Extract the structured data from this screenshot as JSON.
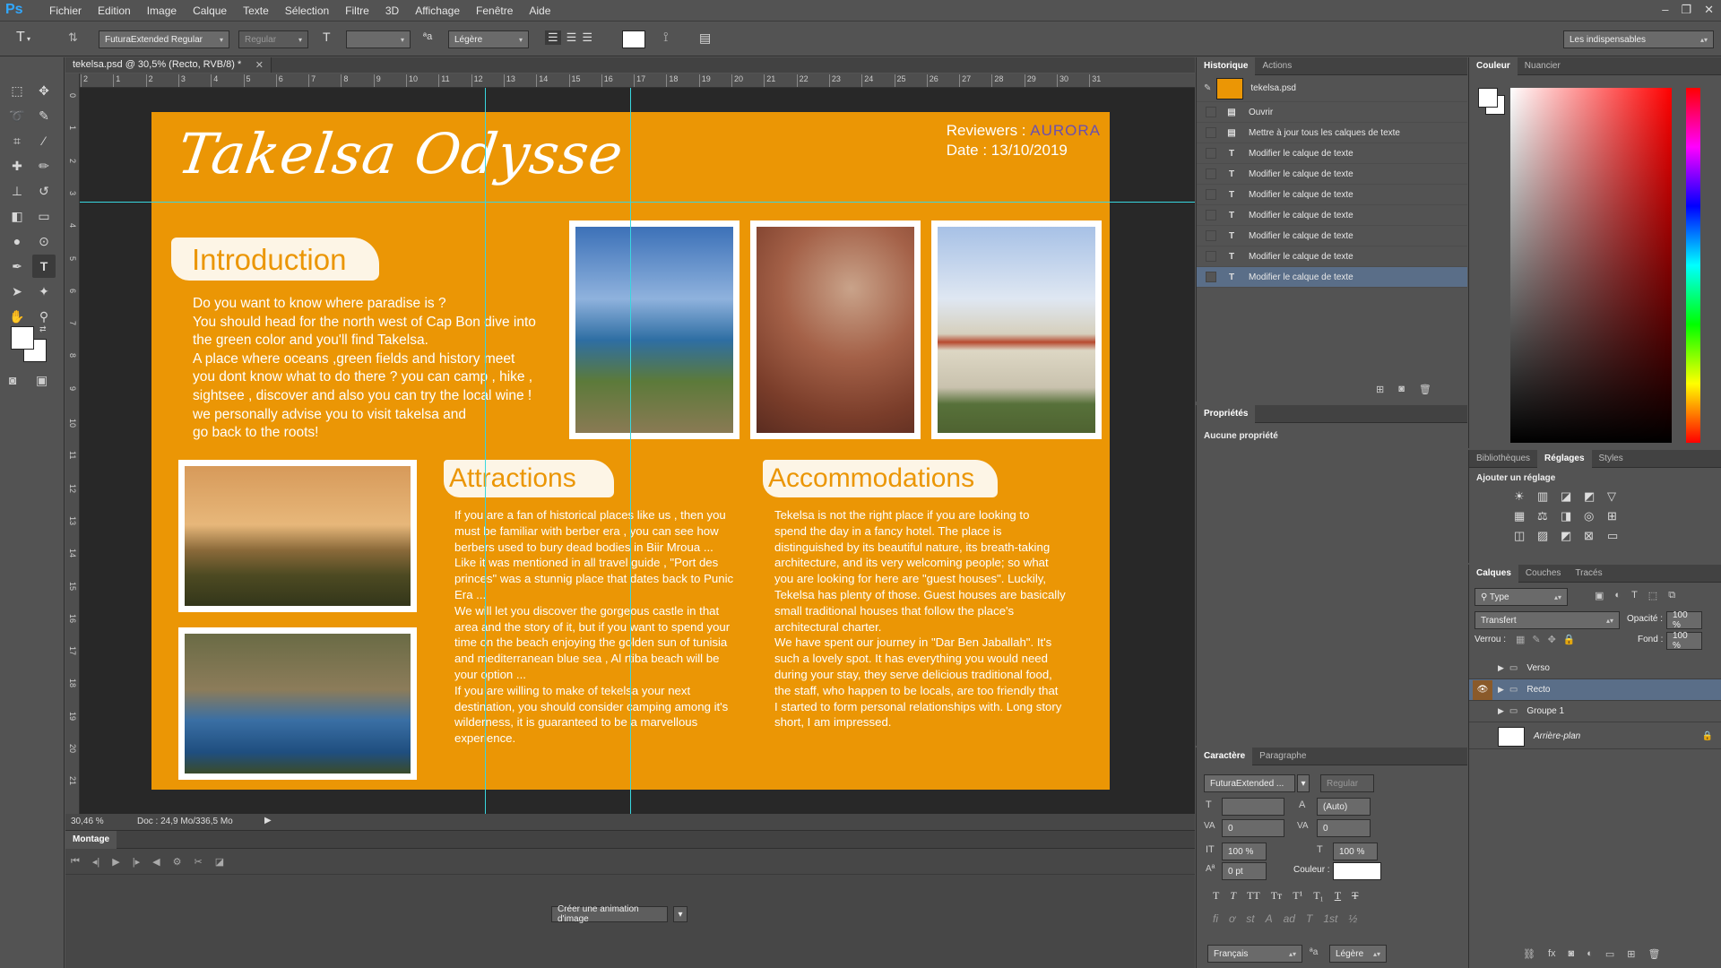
{
  "app": {
    "logo": "Ps"
  },
  "menu": [
    "Fichier",
    "Edition",
    "Image",
    "Calque",
    "Texte",
    "Sélection",
    "Filtre",
    "3D",
    "Affichage",
    "Fenêtre",
    "Aide"
  ],
  "options": {
    "font_family": "FuturaExtended Regular",
    "font_style": "Regular",
    "antialias": "Légère",
    "workspace": "Les indispensables"
  },
  "document": {
    "tab_title": "tekelsa.psd @ 30,5% (Recto, RVB/8) *",
    "zoom": "30,46 %",
    "doc_info": "Doc : 24,9 Mo/336,5 Mo",
    "ruler_h": [
      "2",
      "1",
      "2",
      "3",
      "4",
      "5",
      "6",
      "7",
      "8",
      "9",
      "10",
      "11",
      "12",
      "13",
      "14",
      "15",
      "16",
      "17",
      "18",
      "19",
      "20",
      "21",
      "22",
      "23",
      "24",
      "25",
      "26",
      "27",
      "28",
      "29",
      "30",
      "31"
    ],
    "ruler_v": [
      "0",
      "1",
      "2",
      "3",
      "4",
      "5",
      "6",
      "7",
      "8",
      "9",
      "10",
      "11",
      "12",
      "13",
      "14",
      "15",
      "16",
      "17",
      "18",
      "19",
      "20",
      "21"
    ]
  },
  "artwork": {
    "title": "Takelsa Odysse",
    "reviewers_label": "Reviewers :",
    "reviewers_brand": "AURORA",
    "date": "Date : 13/10/2019",
    "intro_heading": "Introduction",
    "intro_lines": [
      "Do you want to know where paradise is ?",
      "You should head for the north west of Cap Bon dive into",
      "the green color and you'll find Takelsa.",
      "A place where oceans ,green fields and history  meet",
      "you dont know what to do there ? you can camp , hike ,",
      "sightsee , discover and also you can try the local wine !",
      "we personally advise you to visit takelsa and",
      "go back to the roots!"
    ],
    "attractions_heading": "Attractions",
    "attractions_lines": [
      "If you are a fan of historical places like us , then you",
      "must be familiar with berber era , you can see how",
      "berbers used to bury dead bodies in Biir Mroua ...",
      "Like it was mentioned in all travel guide , \"Port des",
      "princes\"  was a stunnig place that dates back to Punic",
      "Era ...",
      "We will let you discover the gorgeous castle in that",
      "area and the story of it, but if you want to spend your",
      "time on the beach enjoying the golden sun of tunisia",
      "and mediterranean blue sea , Al rtiba beach will be",
      "your option ...",
      "If you are willing to make of tekelsa your next",
      "destination, you should consider camping among it's",
      "wilderness, it is guaranteed to be a marvellous",
      "experience."
    ],
    "accommodations_heading": "Accommodations",
    "accommodations_lines": [
      "Tekelsa is not the right place if you are looking to",
      "spend the day in a fancy hotel. The place is",
      "distinguished by its beautiful nature, its breath-taking",
      "architecture, and its very welcoming people; so what",
      "you are looking for here are \"guest houses\". Luckily,",
      "Tekelsa has plenty of those. Guest houses are basically",
      "small traditional houses that follow the place's",
      "architectural charter.",
      "We have spent our journey in \"Dar Ben Jaballah\". It's",
      "such a lovely spot. It has everything you would need",
      "during your stay, they serve delicious traditional food,",
      "the staff, who happen to be locals, are too friendly that",
      "I started to form personal relationships with. Long story",
      "short, I am impressed."
    ]
  },
  "timeline": {
    "title": "Montage",
    "create_button": "Créer une animation d'image"
  },
  "history": {
    "tabs": [
      "Historique",
      "Actions"
    ],
    "snapshot": "tekelsa.psd",
    "items": [
      {
        "label": "Ouvrir",
        "icon": "doc"
      },
      {
        "label": "Mettre à jour tous les calques de texte",
        "icon": "doc"
      },
      {
        "label": "Modifier le calque de texte",
        "icon": "T"
      },
      {
        "label": "Modifier le calque de texte",
        "icon": "T"
      },
      {
        "label": "Modifier le calque de texte",
        "icon": "T"
      },
      {
        "label": "Modifier le calque de texte",
        "icon": "T"
      },
      {
        "label": "Modifier le calque de texte",
        "icon": "T"
      },
      {
        "label": "Modifier le calque de texte",
        "icon": "T"
      },
      {
        "label": "Modifier le calque de texte",
        "icon": "T"
      }
    ]
  },
  "properties": {
    "title": "Propriétés",
    "empty": "Aucune propriété"
  },
  "character": {
    "tabs": [
      "Caractère",
      "Paragraphe"
    ],
    "font": "FuturaExtended ...",
    "style": "Regular",
    "leading": "(Auto)",
    "tracking": "0",
    "kerning": "0",
    "vscale": "100 %",
    "hscale": "100 %",
    "baseline": "0 pt",
    "color_label": "Couleur :",
    "language": "Français",
    "aa": "Légère"
  },
  "color_panel": {
    "tabs": [
      "Couleur",
      "Nuancier"
    ]
  },
  "adjustments": {
    "tabs": [
      "Bibliothèques",
      "Réglages",
      "Styles"
    ],
    "title": "Ajouter un réglage"
  },
  "layers": {
    "tabs": [
      "Calques",
      "Couches",
      "Tracés"
    ],
    "filter": "Type",
    "blend": "Transfert",
    "opacity_label": "Opacité :",
    "opacity": "100 %",
    "lock_label": "Verrou :",
    "fill_label": "Fond :",
    "fill": "100 %",
    "items": [
      {
        "name": "Verso",
        "visible": false,
        "selected": false
      },
      {
        "name": "Recto",
        "visible": true,
        "selected": true
      },
      {
        "name": "Groupe 1",
        "visible": false,
        "selected": false
      }
    ],
    "background": "Arrière-plan"
  },
  "colors": {
    "accent": "#eb9605",
    "panel": "#535353",
    "selection": "#5a6e88",
    "guide": "#38d7e0"
  }
}
